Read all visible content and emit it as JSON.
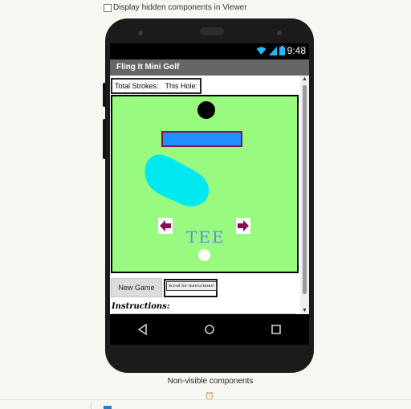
{
  "viewer": {
    "hidden_components_label": "Display hidden components in Viewer",
    "hidden_components_checked": false,
    "nonvisible_label": "Non-visible components"
  },
  "phone": {
    "status": {
      "time": "9:48",
      "icons": [
        "wifi-icon",
        "signal-icon",
        "battery-icon"
      ]
    },
    "app_title": "Fling It Mini Golf",
    "strokes": {
      "total_label": "Total Strokes:",
      "hole_label": "This Hole:"
    },
    "canvas": {
      "tee_label": "TEE",
      "colors": {
        "grass": "#98fb80",
        "wall": "#1e90ff",
        "wall_border": "#8b0a50",
        "pond": "#00e8f0",
        "hole": "#000000",
        "ball": "#ffffff",
        "arrow": "#8b0a50",
        "tee_text": "#6a8bd8"
      }
    },
    "buttons": {
      "new_game": "New Game",
      "scroll_instructions": "Scroll for instructions!"
    },
    "instructions_title": "Instructions:",
    "nav": [
      "back-icon",
      "home-icon",
      "recents-icon"
    ]
  }
}
